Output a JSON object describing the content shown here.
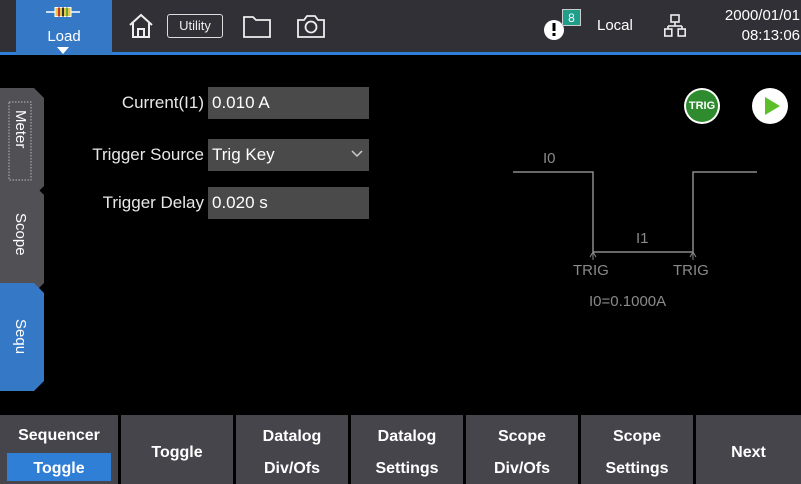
{
  "topbar": {
    "load_label": "Load",
    "utility_label": "Utility",
    "notification_count": "8",
    "remote_status": "Local",
    "date": "2000/01/01",
    "time": "08:13:06"
  },
  "side_tabs": [
    {
      "label": "Meter"
    },
    {
      "label": "Scope"
    },
    {
      "label": "Sequ"
    }
  ],
  "form": {
    "current_label": "Current(I1)",
    "current_value": "0.010 A",
    "trigger_source_label": "Trigger Source",
    "trigger_source_value": "Trig Key",
    "trigger_delay_label": "Trigger Delay",
    "trigger_delay_value": "0.020 s"
  },
  "controls": {
    "trig_label": "TRIG"
  },
  "waveform": {
    "i0_label": "I0",
    "i1_label": "I1",
    "trig_left": "TRIG",
    "trig_right": "TRIG",
    "i0_value": "I0=0.1000A"
  },
  "softkeys": [
    {
      "line1": "Sequencer",
      "line2": "Toggle"
    },
    {
      "line1": "Toggle"
    },
    {
      "line1": "Datalog",
      "line2": "Div/Ofs"
    },
    {
      "line1": "Datalog",
      "line2": "Settings"
    },
    {
      "line1": "Scope",
      "line2": "Div/Ofs"
    },
    {
      "line1": "Scope",
      "line2": "Settings"
    },
    {
      "line1": "Next"
    }
  ],
  "colors": {
    "accent": "#3478c6",
    "topbar": "#303036",
    "softkey": "#45454b",
    "trig_green": "#2e8b2e",
    "play_green": "#5cbf2a"
  }
}
